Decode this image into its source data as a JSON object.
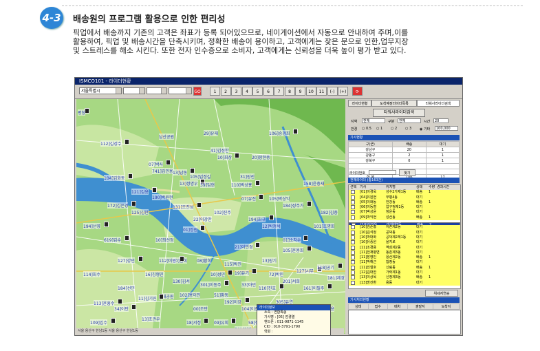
{
  "section": {
    "number": "4-3",
    "title": "배송원의 프로그램 활용으로 인한 편리성",
    "lines": [
      "픽업에서 배송까지 기존의 고객은 좌표가 등록 되어있으므로, 네이게이션에서 자동으로 안내하여 주며,이를",
      "활용하여, 픽업 및 배송시간을 단축시키며, 정확한 배송이 용이하고, 고객에게는 잦은 문으로 인한,업무지장",
      "및 스트레스를 해소 시킨다. 또한 전자 인수증으로 소비자, 고객에게는 신뢰성을 더욱 높이 평가 받고 있다."
    ]
  },
  "app": {
    "title": "ISMCO101 - 라이더현황",
    "toolbar": {
      "region_select": "서울특별시",
      "go_label": "GO",
      "page_buttons": [
        "1",
        "2",
        "3",
        "4",
        "5",
        "6",
        "7",
        "8",
        "9",
        "10",
        "11",
        "(-)",
        "(+)"
      ]
    },
    "tabs": [
      "라이더현황",
      "도착예정라이더목록",
      "타워사라이더검색"
    ],
    "search_button": "타워사라이더검색",
    "filters": {
      "region_label": "지역",
      "region_value": "전체",
      "status_label": "구분",
      "status_value": "전체",
      "time_label": "시간",
      "time_value": "20",
      "radius_label": "반경",
      "radius_options": [
        "0.5",
        "1",
        "2",
        "3",
        "기타"
      ],
      "radius_value": "100,000"
    },
    "rider_status": {
      "header": "기사현황",
      "columns": [
        "구(군)",
        "배송",
        "대기"
      ],
      "rows": [
        [
          "강남구",
          "20",
          "1"
        ],
        [
          "강동구",
          "2",
          "1"
        ],
        [
          "강북구",
          "0",
          "1"
        ]
      ],
      "total": [
        "합  계",
        "106",
        "17"
      ]
    },
    "rider_no_label": "라이더번호",
    "find_button": "찾기",
    "list": {
      "header": "전체라이더 (총163건)",
      "columns": [
        "선택",
        "기사",
        "위치명",
        "상태",
        "수량",
        "경과시간"
      ],
      "rows": [
        [
          "[01]이경욱",
          "성수2가제1동",
          "배송",
          "1",
          "y"
        ],
        [
          "[04]유원현",
          "부평4동",
          "대기",
          "",
          "y"
        ],
        [
          "[05]이화동",
          "한강동",
          "배송",
          "1",
          "y"
        ],
        [
          "[06]이동철",
          "압구정제1동",
          "대기",
          "",
          "y"
        ],
        [
          "[07]박상윤",
          "청운동",
          "대기",
          "",
          "y"
        ],
        [
          "[09]박익현",
          "성산동",
          "배송",
          "1",
          "y"
        ],
        [
          "[10]이민우",
          "대치제3동",
          "배송",
          "2",
          "s"
        ],
        [
          "[10]김준홍",
          "이촌제2동",
          "대기",
          "",
          "y"
        ],
        [
          "[10]김석정",
          "공덕동",
          "대기",
          "",
          "y"
        ],
        [
          "[10]박대화",
          "공덕제2제1동",
          "대기",
          "",
          "y"
        ],
        [
          "[10]유풍원",
          "을지로",
          "대기",
          "",
          "y"
        ],
        [
          "[11]조경용",
          "역삼제2동",
          "대기",
          "",
          "y"
        ],
        [
          "[11]전재평면",
          "동촌제3동",
          "대기",
          "",
          "y"
        ],
        [
          "[11]장영민",
          "용산제2동",
          "배송",
          "1",
          "y"
        ],
        [
          "[11]박해근",
          "합정동",
          "대기",
          "",
          "y"
        ],
        [
          "[11]진철호",
          "신림동",
          "배송",
          "1",
          "y"
        ],
        [
          "[12]김대한",
          "가락제1동",
          "대기",
          "",
          "y"
        ],
        [
          "[13]이상목",
          "신정제3동",
          "배송",
          "1",
          "y"
        ],
        [
          "[13]방진환",
          "용동",
          "대기",
          "",
          "y"
        ]
      ]
    },
    "detail_button": "위세지연승",
    "bottom_table": {
      "header": "기사처리현황",
      "columns": [
        "상태",
        "접수",
        "배차",
        "출발지",
        "도착지"
      ]
    },
    "popup": {
      "header": "라이더정보",
      "rows": [
        "소속 : 연합특송",
        "기사명 : [05] 엄경열",
        "핸드폰 : 011-9871-1145",
        "CID : 010-3791-1790",
        "학원 :"
      ]
    },
    "status_bar": "서울 용산구 한남1동 서울 용산구 한남1동"
  },
  "map": {
    "labels": [
      "평창",
      "남산공원",
      "112]김성수",
      "29]유재",
      "106]송경희",
      "41]김성한",
      "10]최상",
      "20]장현중",
      "07]박사",
      "741]김민용",
      "13]남동",
      "105]임정길",
      "13]정명우",
      "39]임현",
      "104]김화동",
      "31]장진",
      "110]박상홍",
      "158]윤충재",
      "121]김용",
      "190]박원현",
      "172]김은경",
      "125]김만",
      "131]조진성",
      "102]진주",
      "07]유진",
      "105]박상익",
      "184]성주가",
      "182]김충",
      "194]선영",
      "22]이강만",
      "194]최규",
      "12]박정석",
      "01]소차수",
      "101]조명회",
      "105]윤용희",
      "10]김희",
      "127]강민",
      "115]박진",
      "19]유기",
      "72]박민",
      "127]시무",
      "33]아민",
      "110]진호",
      "201]서희",
      "118]공기",
      "51]황동",
      "161]이필주",
      "130]김서",
      "192]이강",
      "00]조만",
      "104]이진희",
      "305]유연",
      "18]서정",
      "106]황용",
      "112]이민",
      "102]용이진",
      "301]이동주",
      "16]김형민",
      "58]장성희",
      "501]김기",
      "34]이만",
      "13]조관우",
      "09]유희",
      "181]제경",
      "18]이서진",
      "184]선민",
      "619]김수",
      "114]최수",
      "109]임수",
      "33]가민",
      "113]윤흥수",
      "보라매공원",
      "한강시민공원",
      "대공원",
      "10]성민",
      "08]황희",
      "21]이민경",
      "13]장기",
      "01]정원",
      "10]최선정",
      "11]김기진"
    ]
  }
}
